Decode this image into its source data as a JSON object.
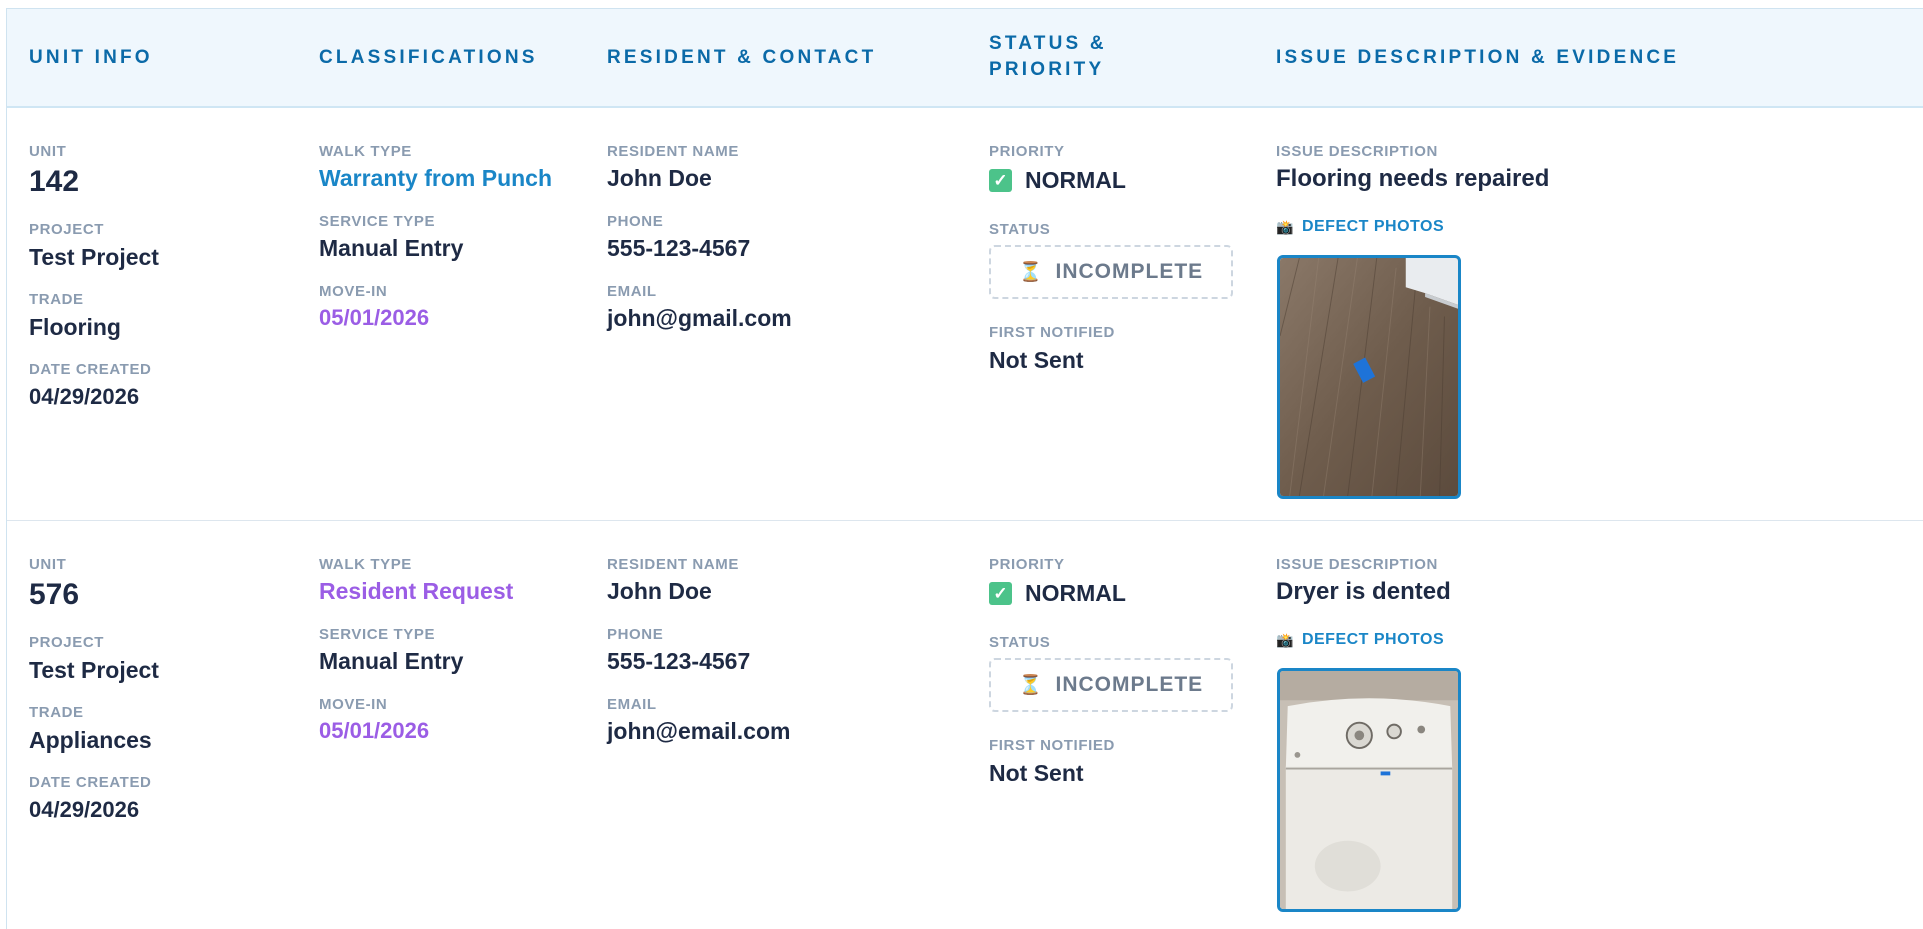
{
  "headers": {
    "unit_info": "UNIT INFO",
    "classifications": "CLASSIFICATIONS",
    "resident_contact": "RESIDENT & CONTACT",
    "status_priority_line1": "STATUS &",
    "status_priority_line2": "PRIORITY",
    "issue_description": "ISSUE DESCRIPTION & EVIDENCE"
  },
  "labels": {
    "unit": "UNIT",
    "project": "PROJECT",
    "trade": "TRADE",
    "date_created": "DATE CREATED",
    "walk_type": "WALK TYPE",
    "service_type": "SERVICE TYPE",
    "move_in": "MOVE-IN",
    "resident_name": "RESIDENT NAME",
    "phone": "PHONE",
    "email": "EMAIL",
    "priority": "PRIORITY",
    "status": "STATUS",
    "first_notified": "FIRST NOTIFIED",
    "issue_description": "ISSUE DESCRIPTION",
    "defect_photos": "DEFECT PHOTOS"
  },
  "rows": [
    {
      "unit": "142",
      "project": "Test Project",
      "trade": "Flooring",
      "date_created": "04/29/2026",
      "walk_type": "Warranty from Punch",
      "service_type": "Manual Entry",
      "move_in": "05/01/2026",
      "resident_name": "John Doe",
      "phone": "555-123-4567",
      "email": "john@gmail.com",
      "priority": "NORMAL",
      "status": "INCOMPLETE",
      "first_notified": "Not Sent",
      "issue_description": "Flooring needs repaired",
      "photo_icon": "flooring-photo"
    },
    {
      "unit": "576",
      "project": "Test Project",
      "trade": "Appliances",
      "date_created": "04/29/2026",
      "walk_type": "Resident Request",
      "service_type": "Manual Entry",
      "move_in": "05/01/2026",
      "resident_name": "John Doe",
      "phone": "555-123-4567",
      "email": "john@email.com",
      "priority": "NORMAL",
      "status": "INCOMPLETE",
      "first_notified": "Not Sent",
      "issue_description": "Dryer is dented",
      "photo_icon": "dryer-photo"
    }
  ],
  "colors": {
    "header_text": "#0b6aa8",
    "accent_blue": "#1a86c7",
    "accent_purple": "#9b5de5",
    "priority_check": "#4cc38a"
  }
}
